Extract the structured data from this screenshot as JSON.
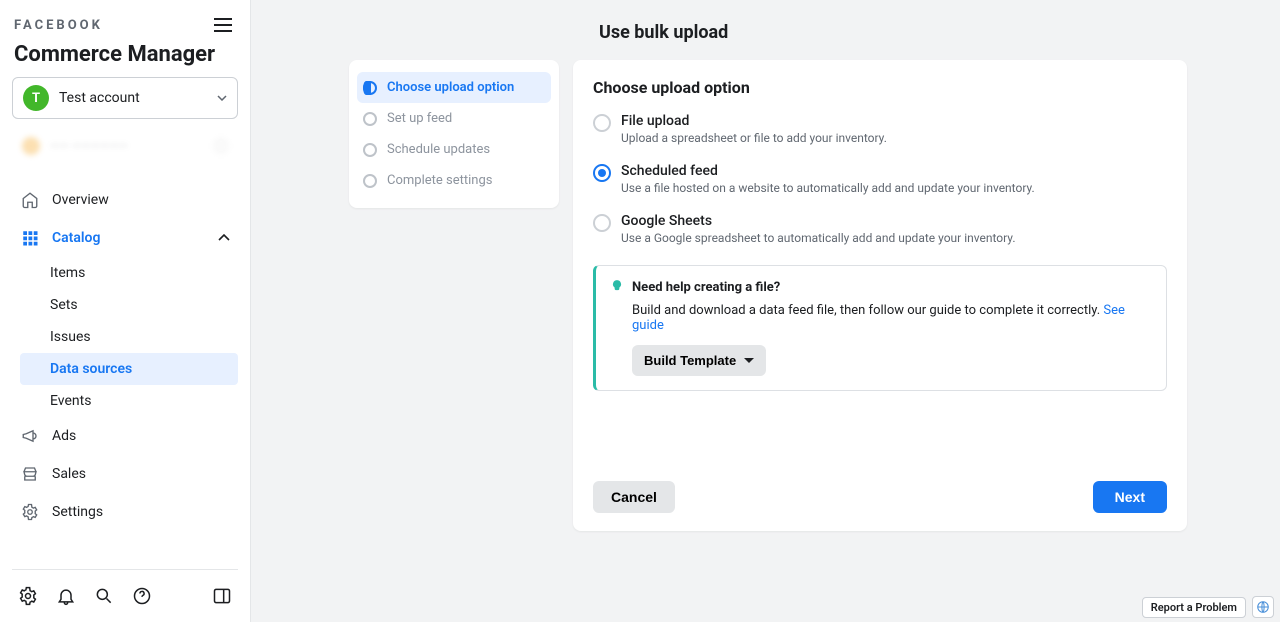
{
  "brand": "FACEBOOK",
  "section": "Commerce Manager",
  "account": {
    "initial": "T",
    "name": "Test account"
  },
  "nav": {
    "overview": "Overview",
    "catalog": "Catalog",
    "catalog_children": {
      "items": "Items",
      "sets": "Sets",
      "issues": "Issues",
      "data_sources": "Data sources",
      "events": "Events"
    },
    "ads": "Ads",
    "sales": "Sales",
    "settings": "Settings"
  },
  "page_title": "Use bulk upload",
  "steps": [
    {
      "label": "Choose upload option",
      "active": true
    },
    {
      "label": "Set up feed",
      "active": false
    },
    {
      "label": "Schedule updates",
      "active": false
    },
    {
      "label": "Complete settings",
      "active": false
    }
  ],
  "form": {
    "title": "Choose upload option",
    "options": [
      {
        "key": "file",
        "label": "File upload",
        "desc": "Upload a spreadsheet or file to add your inventory.",
        "selected": false
      },
      {
        "key": "sched",
        "label": "Scheduled feed",
        "desc": "Use a file hosted on a website to automatically add and update your inventory.",
        "selected": true
      },
      {
        "key": "gs",
        "label": "Google Sheets",
        "desc": "Use a Google spreadsheet to automatically add and update your inventory.",
        "selected": false
      }
    ],
    "tip": {
      "title": "Need help creating a file?",
      "body_prefix": "Build and download a data feed file, then follow our guide to complete it correctly. ",
      "link": "See guide",
      "build_template": "Build Template"
    },
    "cancel": "Cancel",
    "next": "Next"
  },
  "report_problem": "Report a Problem"
}
